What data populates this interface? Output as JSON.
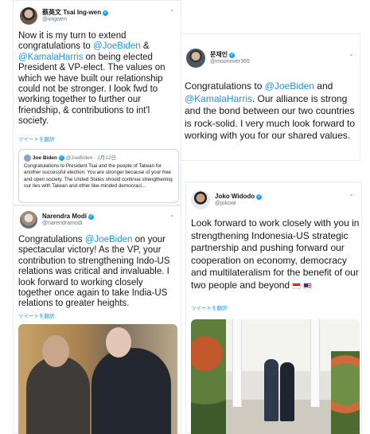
{
  "tsai": {
    "name": "蔡英文 Tsai Ing-wen",
    "handle": "@iingwen",
    "text_pre": "Now it is my turn to extend congratulations to ",
    "mention1": "@JoeBiden",
    "text_mid": " & ",
    "mention2": "@KamalaHarris",
    "text_post": " on being elected President & VP-elect. The values on which we have built our relationship could not be stronger. I look fwd to working together to further our friendship, & contributions to int'l society.",
    "translate": "ツイートを翻訳",
    "quote": {
      "name": "Joe Biden",
      "handle": "@JoeBiden",
      "date": "1月12日",
      "text": "Congratulations to President Tsai and the people of Taiwan for another successful election. You are stronger because of your free and open society. The United States should continue strengthening our ties with Taiwan and other like-minded democraci..."
    }
  },
  "modi": {
    "name": "Narendra Modi",
    "handle": "@narendramodi",
    "text_pre": "Congratulations ",
    "mention1": "@JoeBiden",
    "text_post": " on your spectacular victory! As the VP, your contribution to strengthening Indo-US relations was critical and invaluable. I look forward to working closely together once again to take India-US relations to greater heights.",
    "translate": "ツイートを翻訳"
  },
  "moon": {
    "name": "문재인",
    "handle": "@moonriver365",
    "text_pre": "Congratulations to ",
    "mention1": "@JoeBiden",
    "text_mid": " and ",
    "mention2": "@KamalaHarris",
    "text_post": ". Our alliance is strong and the bond between our two countries is rock-solid. I very much look forward to working with you for our shared values."
  },
  "jokowi": {
    "name": "Joko Widodo",
    "handle": "@jokowi",
    "text": "Look forward to work closely with you in strengthening Indonesia-US strategic partnership and pushing forward our cooperation on economy, democracy and multilateralism for the benefit of our two people and beyond",
    "translate": "ツイートを翻訳"
  },
  "colors": {
    "link": "#1b95e0",
    "verified": "#1da1f2",
    "muted": "#657786",
    "border": "#e6ecf0"
  },
  "icons": {
    "verified": "verified-badge-icon",
    "menu": "chevron-down-icon"
  }
}
